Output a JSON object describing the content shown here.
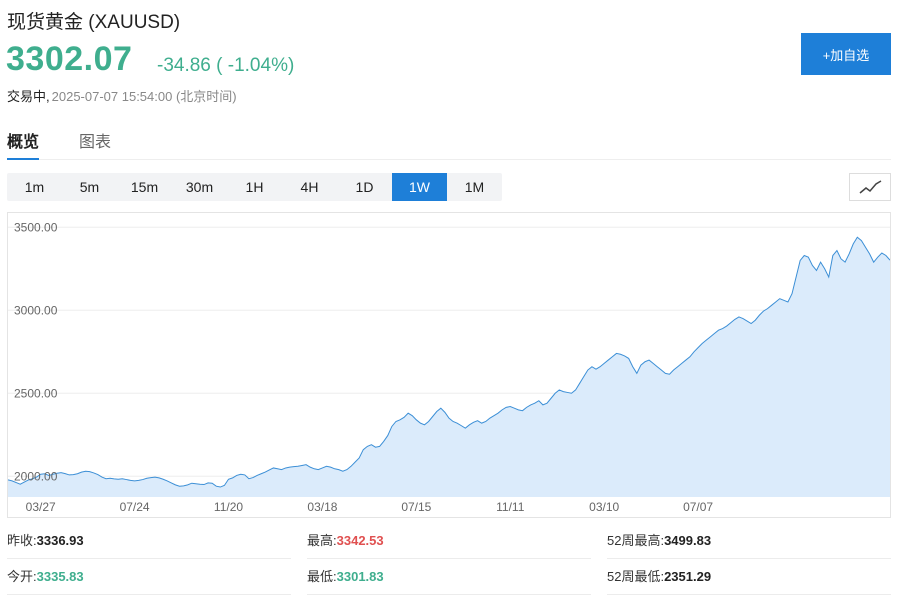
{
  "header": {
    "name": "现货黄金",
    "symbol": "(XAUUSD)",
    "price": "3302.07",
    "change": "-34.86",
    "change_pct": "( -1.04%)",
    "status": "交易中,",
    "timestamp": "2025-07-07 15:54:00 (北京时间)",
    "watchlist_button": "+加自选"
  },
  "tabs": [
    {
      "label": "概览",
      "active": true
    },
    {
      "label": "图表",
      "active": false
    }
  ],
  "intervals": [
    {
      "label": "1m",
      "active": false
    },
    {
      "label": "5m",
      "active": false
    },
    {
      "label": "15m",
      "active": false
    },
    {
      "label": "30m",
      "active": false
    },
    {
      "label": "1H",
      "active": false
    },
    {
      "label": "4H",
      "active": false
    },
    {
      "label": "1D",
      "active": false
    },
    {
      "label": "1W",
      "active": true
    },
    {
      "label": "1M",
      "active": false
    }
  ],
  "chart_toggle_icon": "line-chart-icon",
  "chart_data": {
    "type": "area",
    "ylim": [
      1875,
      3550
    ],
    "yticks": [
      {
        "value": 2000,
        "label": "2000.00"
      },
      {
        "value": 2500,
        "label": "2500.00"
      },
      {
        "value": 3000,
        "label": "3000.00"
      },
      {
        "value": 3500,
        "label": "3500.00"
      }
    ],
    "xticks": [
      {
        "index": 8,
        "label": "03/27"
      },
      {
        "index": 31,
        "label": "07/24"
      },
      {
        "index": 54,
        "label": "11/20"
      },
      {
        "index": 77,
        "label": "03/18"
      },
      {
        "index": 100,
        "label": "07/15"
      },
      {
        "index": 123,
        "label": "11/11"
      },
      {
        "index": 146,
        "label": "03/10"
      },
      {
        "index": 169,
        "label": "07/07"
      }
    ],
    "values": [
      1978,
      1972,
      1962,
      1952,
      1965,
      1978,
      1985,
      1995,
      2012,
      2015,
      2005,
      2012,
      2018,
      2022,
      2016,
      2008,
      2010,
      2015,
      2025,
      2030,
      2028,
      2020,
      2010,
      1995,
      1985,
      1988,
      1984,
      1982,
      1985,
      1980,
      1975,
      1972,
      1975,
      1980,
      1988,
      1992,
      1995,
      1990,
      1982,
      1972,
      1960,
      1948,
      1940,
      1942,
      1948,
      1958,
      1955,
      1952,
      1950,
      1960,
      1958,
      1940,
      1935,
      1945,
      1982,
      1990,
      2005,
      2012,
      2008,
      1985,
      1992,
      2005,
      2015,
      2025,
      2038,
      2050,
      2045,
      2040,
      2050,
      2055,
      2058,
      2060,
      2065,
      2070,
      2055,
      2045,
      2040,
      2050,
      2060,
      2055,
      2045,
      2040,
      2030,
      2040,
      2060,
      2085,
      2110,
      2160,
      2180,
      2190,
      2175,
      2180,
      2210,
      2245,
      2300,
      2330,
      2340,
      2355,
      2380,
      2365,
      2340,
      2320,
      2310,
      2330,
      2360,
      2390,
      2410,
      2385,
      2350,
      2330,
      2320,
      2305,
      2290,
      2310,
      2325,
      2335,
      2320,
      2330,
      2350,
      2365,
      2380,
      2400,
      2415,
      2420,
      2410,
      2400,
      2395,
      2415,
      2430,
      2440,
      2455,
      2430,
      2440,
      2470,
      2500,
      2520,
      2510,
      2505,
      2500,
      2520,
      2560,
      2600,
      2640,
      2660,
      2645,
      2660,
      2680,
      2700,
      2720,
      2740,
      2735,
      2725,
      2710,
      2660,
      2620,
      2670,
      2690,
      2700,
      2680,
      2660,
      2640,
      2620,
      2615,
      2640,
      2660,
      2680,
      2700,
      2720,
      2750,
      2775,
      2800,
      2820,
      2840,
      2860,
      2880,
      2890,
      2905,
      2925,
      2945,
      2960,
      2950,
      2935,
      2920,
      2940,
      2970,
      2995,
      3010,
      3030,
      3050,
      3070,
      3060,
      3050,
      3100,
      3200,
      3300,
      3330,
      3320,
      3270,
      3240,
      3290,
      3250,
      3200,
      3330,
      3360,
      3310,
      3290,
      3340,
      3400,
      3440,
      3420,
      3380,
      3340,
      3290,
      3320,
      3345,
      3330,
      3302
    ]
  },
  "stats": [
    {
      "label": "昨收:",
      "value": "3336.93",
      "trend": "neutral"
    },
    {
      "label": "最高:",
      "value": "3342.53",
      "trend": "up"
    },
    {
      "label": "52周最高:",
      "value": "3499.83",
      "trend": "neutral"
    },
    {
      "label": "今开:",
      "value": "3335.83",
      "trend": "down"
    },
    {
      "label": "最低:",
      "value": "3301.83",
      "trend": "down"
    },
    {
      "label": "52周最低:",
      "value": "2351.29",
      "trend": "neutral"
    }
  ],
  "colors": {
    "accent": "#1e7fd8",
    "down": "#3fae8e",
    "up": "#e05050",
    "line": "#3c8fd6",
    "area": "#dbebfb"
  }
}
